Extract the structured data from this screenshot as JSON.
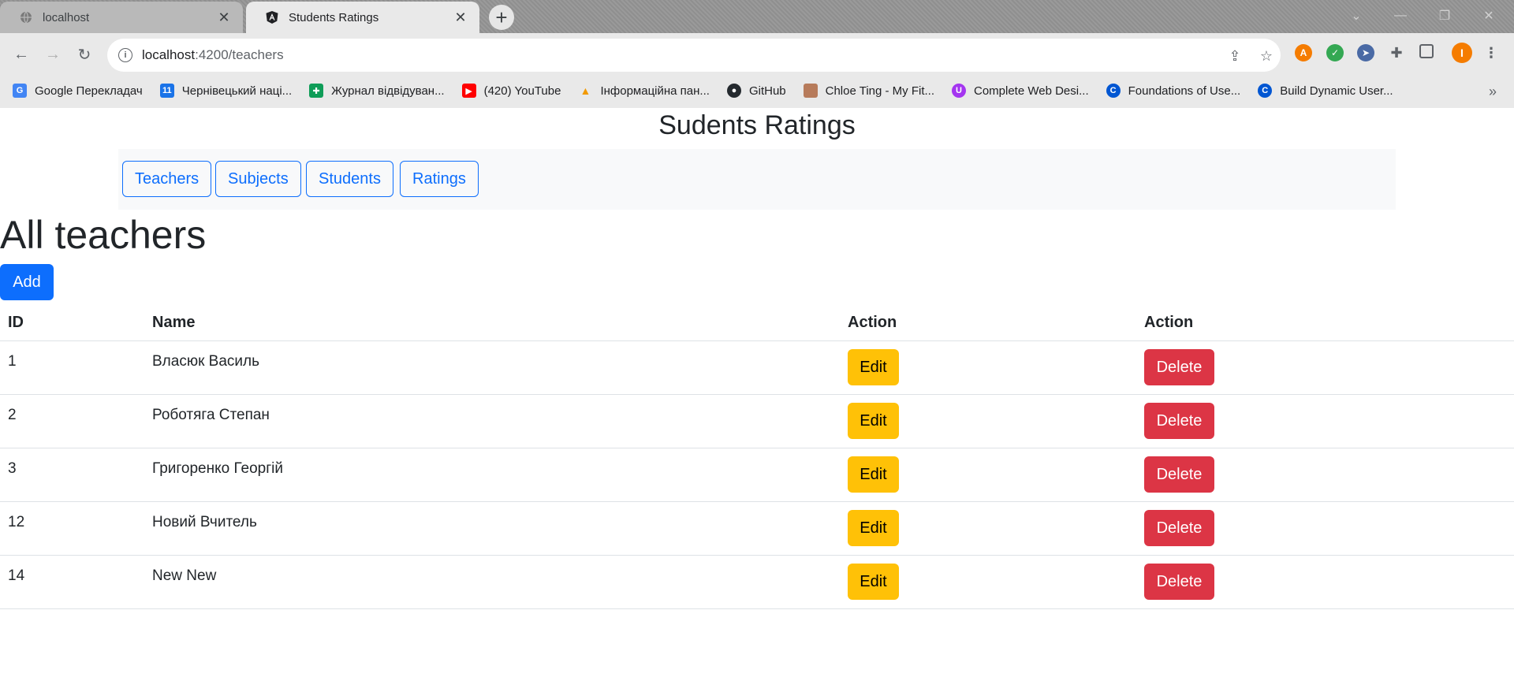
{
  "browser": {
    "tabs": [
      {
        "title": "localhost",
        "active": false
      },
      {
        "title": "Students Ratings",
        "active": true
      }
    ],
    "new_tab_label": "+",
    "url_host": "localhost",
    "url_path": ":4200/teachers",
    "bookmarks": [
      {
        "label": "Google Перекладач",
        "icon": "google-translate-icon",
        "color": "#4285f4"
      },
      {
        "label": "Чернівецький наці...",
        "icon": "calendar-icon",
        "color": "#1a73e8"
      },
      {
        "label": "Журнал відвідуван...",
        "icon": "sheets-icon",
        "color": "#0f9d58"
      },
      {
        "label": "(420) YouTube",
        "icon": "youtube-icon",
        "color": "#ff0000"
      },
      {
        "label": "Інформаційна пан...",
        "icon": "info-panel-icon",
        "color": "#f29900"
      },
      {
        "label": "GitHub",
        "icon": "github-icon",
        "color": "#24292e"
      },
      {
        "label": "Chloe Ting - My Fit...",
        "icon": "avatar-icon",
        "color": "#b77b5b"
      },
      {
        "label": "Complete Web Desi...",
        "icon": "udemy-icon",
        "color": "#a435f0"
      },
      {
        "label": "Foundations of Use...",
        "icon": "coursera-icon",
        "color": "#0056d2"
      },
      {
        "label": "Build Dynamic User...",
        "icon": "coursera-icon",
        "color": "#0056d2"
      }
    ],
    "profile_initial": "I"
  },
  "site": {
    "title": "Sudents Ratings",
    "nav": [
      "Teachers",
      "Subjects",
      "Students",
      "Ratings"
    ]
  },
  "main": {
    "heading": "All teachers",
    "add_label": "Add",
    "table": {
      "headers": [
        "ID",
        "Name",
        "Action",
        "Action"
      ],
      "edit_label": "Edit",
      "delete_label": "Delete",
      "rows": [
        {
          "id": "1",
          "name": "Власюк Василь"
        },
        {
          "id": "2",
          "name": "Роботяга Степан"
        },
        {
          "id": "3",
          "name": "Григоренко Георгій"
        },
        {
          "id": "12",
          "name": "Новий Вчитель"
        },
        {
          "id": "14",
          "name": "New New"
        }
      ]
    }
  },
  "colors": {
    "primary": "#0d6efd",
    "warning": "#ffc107",
    "danger": "#dc3545"
  }
}
